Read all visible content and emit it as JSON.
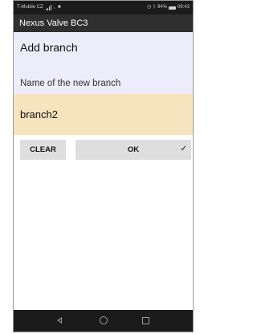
{
  "status_bar": {
    "carrier": "T-Mobile CZ",
    "battery_percent": "94%",
    "time": "09:43",
    "icons": [
      "signal-icon",
      "wifi-icon",
      "notification-icon",
      "alarm-icon",
      "bluetooth-icon",
      "battery-icon"
    ]
  },
  "app_bar": {
    "title": "Nexus Valve BC3"
  },
  "dialog": {
    "title": "Add branch",
    "field_label": "Name of the new branch",
    "field_value": "branch2",
    "clear_label": "CLEAR",
    "ok_label": "OK",
    "ok_icon": "check-icon"
  },
  "nav_bar": {
    "icons": [
      "back-icon",
      "home-icon",
      "recents-icon"
    ]
  },
  "colors": {
    "status_bar_bg": "#1b1b1b",
    "app_bar_bg": "#2f2f2f",
    "dialog_bg": "#ececfb",
    "input_bg": "#f7e3bd",
    "button_bg": "#dedede"
  }
}
